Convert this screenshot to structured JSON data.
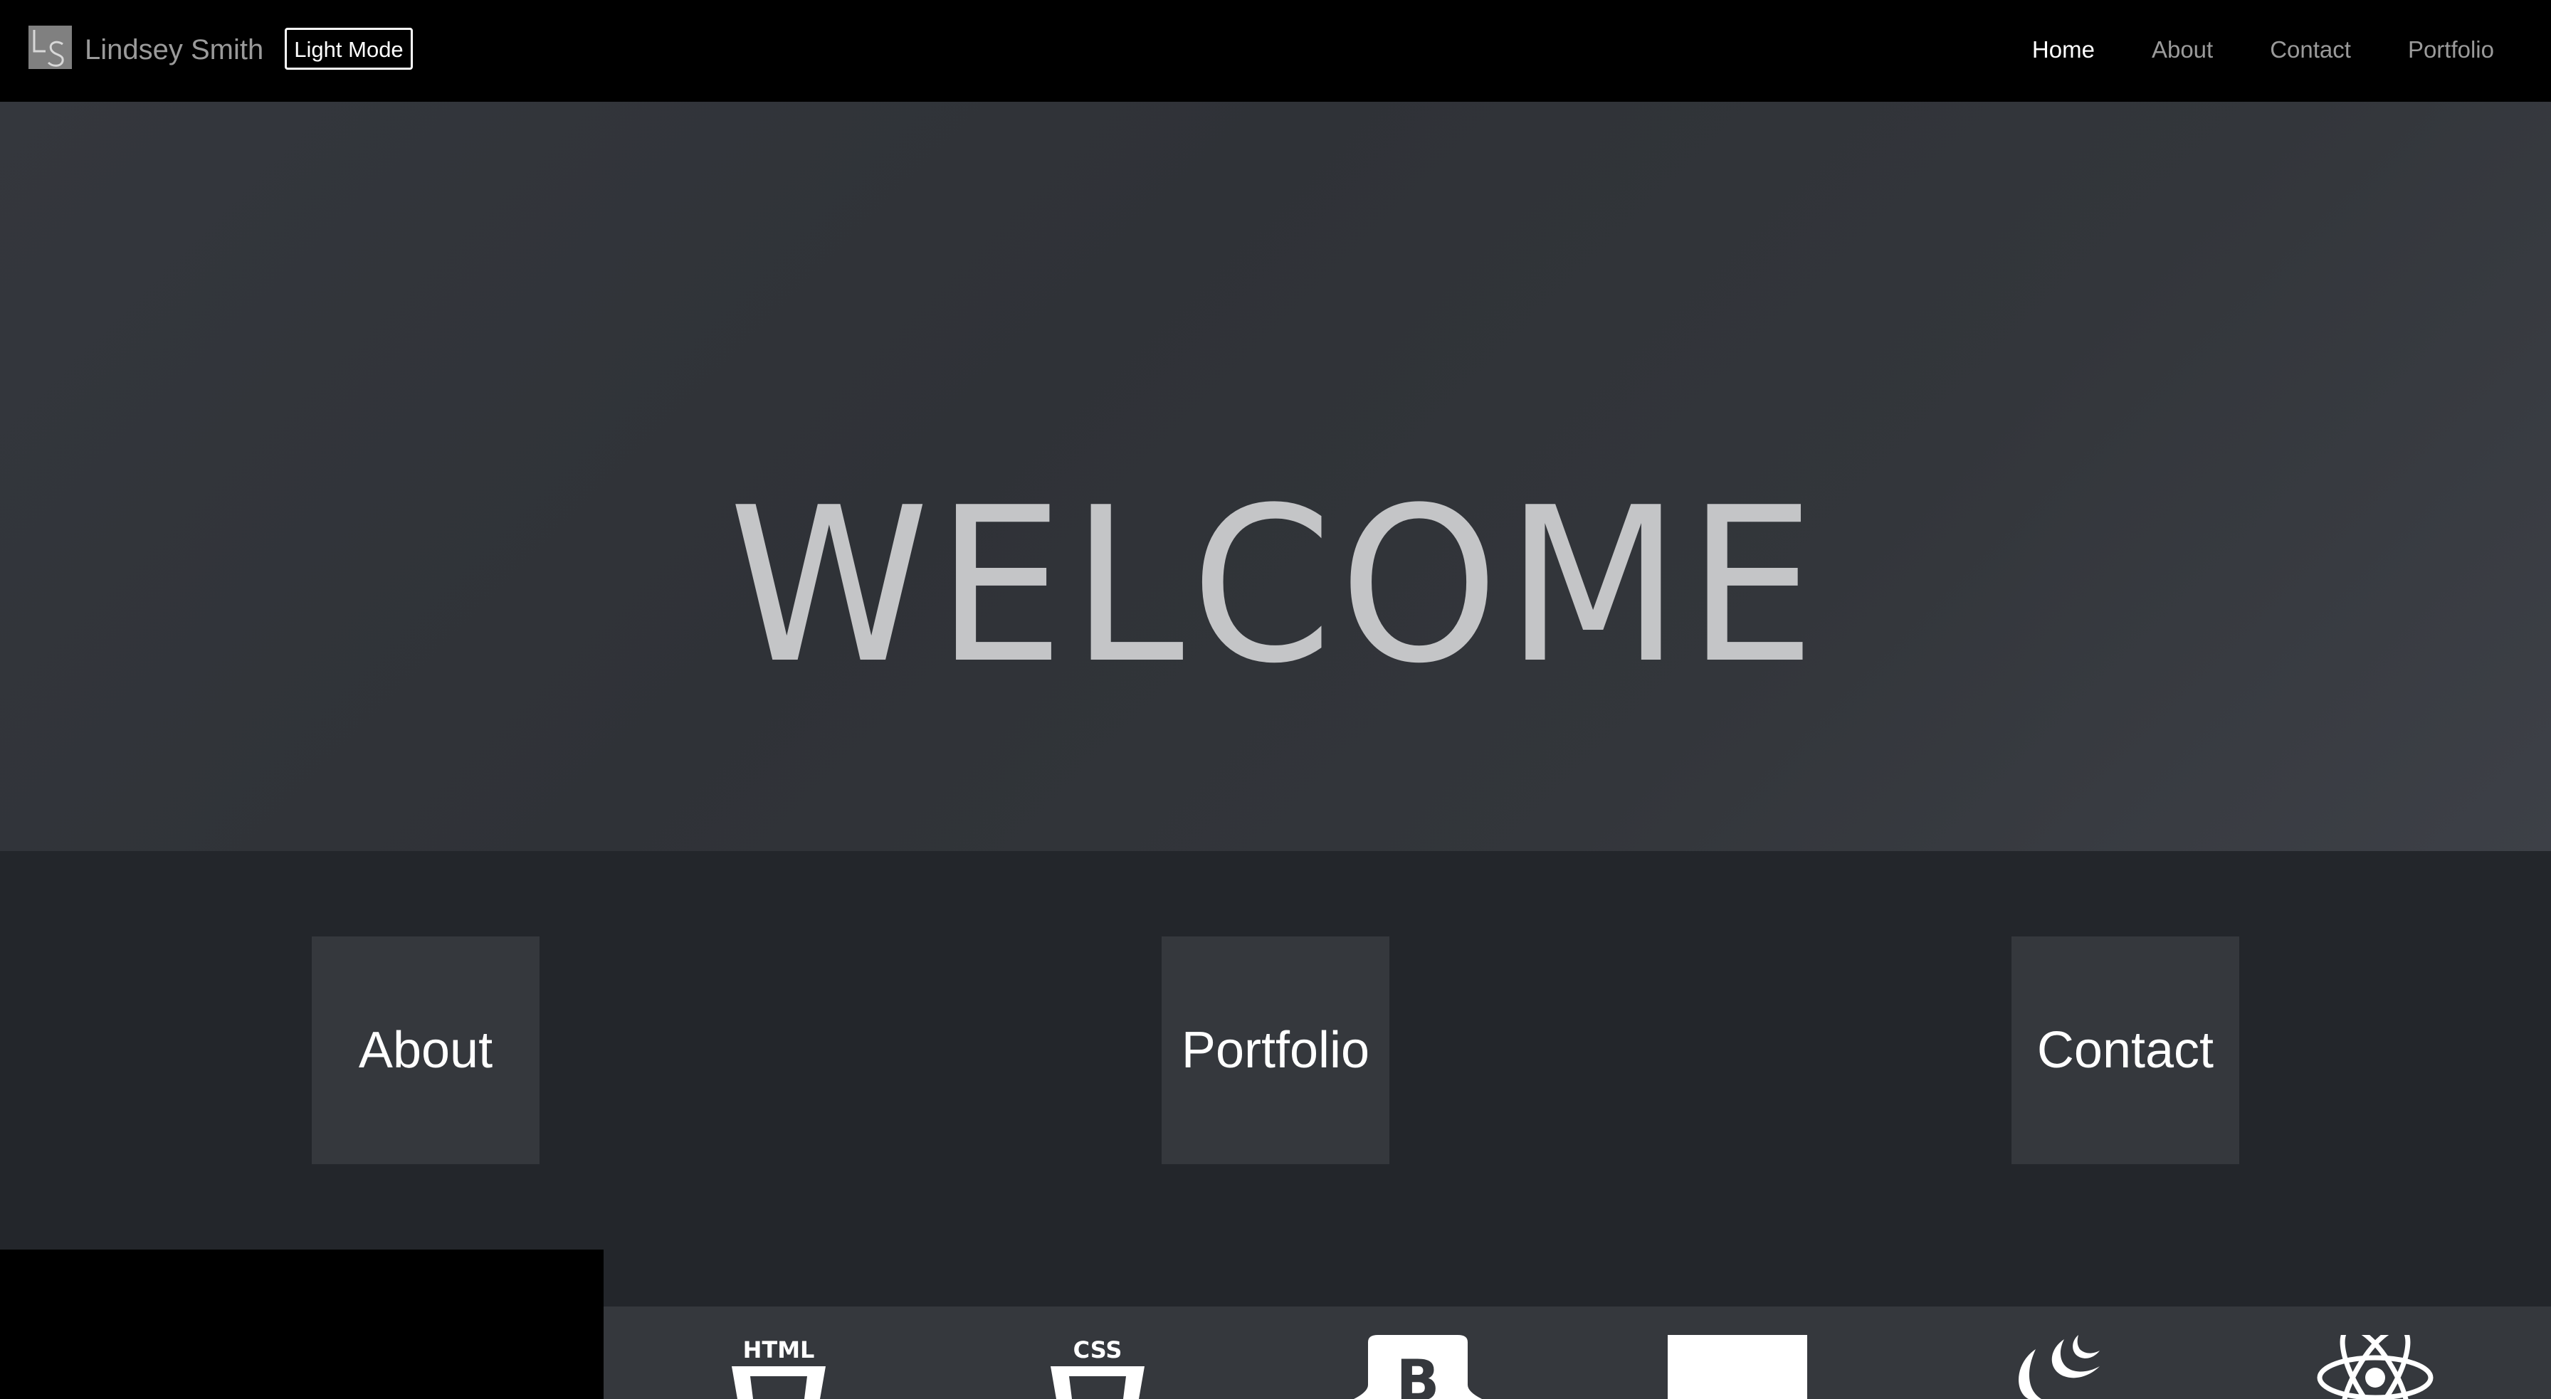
{
  "navbar": {
    "brand_logo_text": "LS",
    "brand_name": "Lindsey Smith",
    "mode_button": "Light Mode",
    "links": [
      {
        "label": "Home",
        "active": true
      },
      {
        "label": "About",
        "active": false
      },
      {
        "label": "Contact",
        "active": false
      },
      {
        "label": "Portfolio",
        "active": false
      }
    ]
  },
  "hero": {
    "title": "WELCOME"
  },
  "cards": [
    {
      "label": "About"
    },
    {
      "label": "Portfolio"
    },
    {
      "label": "Contact"
    }
  ],
  "skills": {
    "icons": [
      {
        "name": "html5-icon",
        "text": "HTML"
      },
      {
        "name": "css3-icon",
        "text": "CSS"
      },
      {
        "name": "bootstrap-icon",
        "text": "B"
      },
      {
        "name": "javascript-icon"
      },
      {
        "name": "jquery-icon"
      },
      {
        "name": "react-icon"
      }
    ]
  },
  "colors": {
    "navbar_bg": "#000000",
    "hero_text": "#c4c5c7",
    "card_bg": "#35383d",
    "section_bg": "#23262b"
  }
}
